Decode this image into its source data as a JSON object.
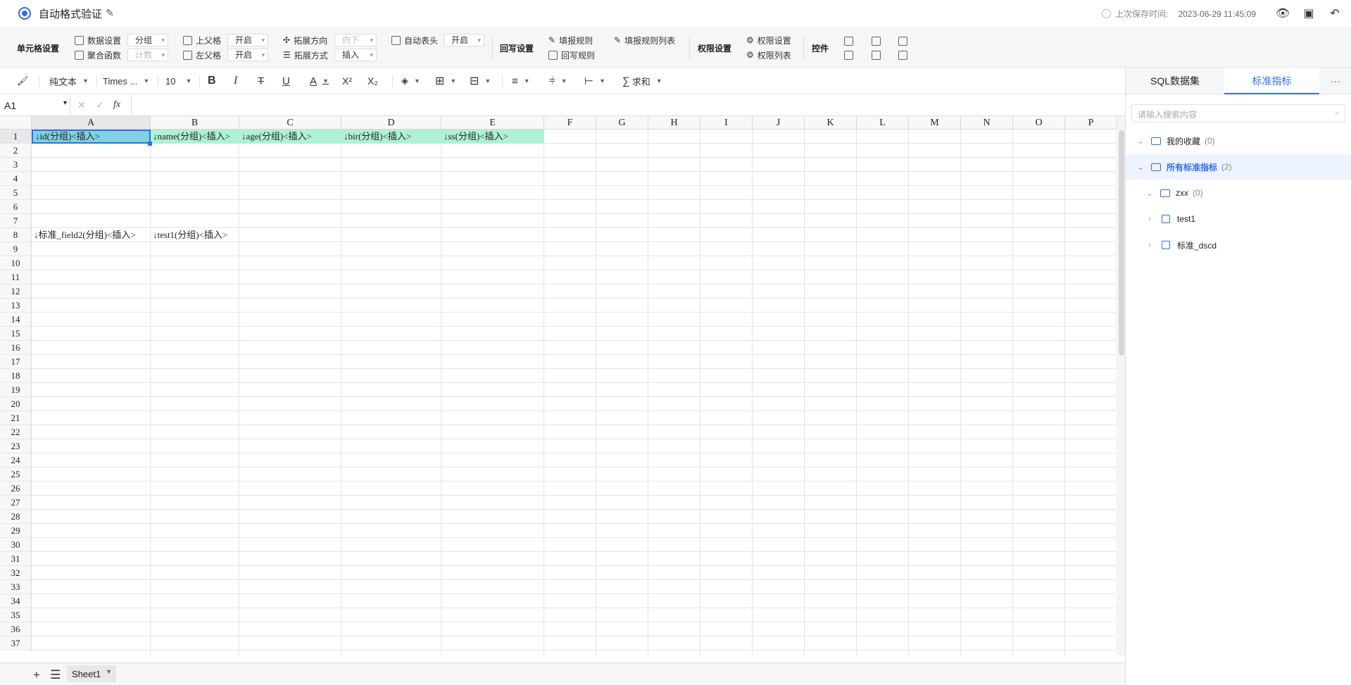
{
  "header": {
    "title": "自动格式验证",
    "save_label": "上次保存时间:",
    "save_time": "2023-06-29 11:45:09"
  },
  "ribbon": {
    "cell_settings": "单元格设置",
    "data_settings": "数据设置",
    "data_settings_value": "分组",
    "agg_func": "聚合函数",
    "agg_func_value": "计数",
    "upper_parent": "上父格",
    "upper_parent_value": "开启",
    "left_parent": "左父格",
    "left_parent_value": "开启",
    "expand_dir": "拓展方向",
    "expand_dir_value": "向下",
    "expand_mode": "拓展方式",
    "expand_mode_value": "插入",
    "auto_header": "自动表头",
    "auto_header_value": "开启",
    "writeback_settings": "回写设置",
    "fill_rules": "填报规则",
    "fill_rules_list": "填报规则列表",
    "writeback_rules": "回写规则",
    "permission_settings_group": "权限设置",
    "permission_settings": "权限设置",
    "permission_list": "权限列表",
    "controls": "控件"
  },
  "toolbar": {
    "format": "纯文本",
    "font": "Times ...",
    "size": "10",
    "sum": "求和"
  },
  "formula_bar": {
    "cell_ref": "A1",
    "fx": "fx"
  },
  "sheet": {
    "columns": [
      "A",
      "B",
      "C",
      "D",
      "E",
      "F",
      "G",
      "H",
      "I",
      "J",
      "K",
      "L",
      "M",
      "N",
      "O",
      "P"
    ],
    "rows": [
      "1",
      "2",
      "3",
      "4",
      "5",
      "6",
      "7",
      "8",
      "9",
      "10",
      "11",
      "12",
      "13",
      "14",
      "15",
      "16",
      "17",
      "18",
      "19",
      "20",
      "21",
      "22",
      "23",
      "24",
      "25",
      "26",
      "27",
      "28",
      "29",
      "30",
      "31",
      "32",
      "33",
      "34",
      "35",
      "36",
      "37"
    ],
    "row1": [
      "↓id(分组)<插入>",
      "↓name(分组)<插入>",
      "↓age(分组)<插入>",
      "↓bir(分组)<插入>",
      "↓ss(分组)<插入>"
    ],
    "row8": [
      "↓标准_field2(分组)<插入>",
      "↓test1(分组)<插入>"
    ]
  },
  "bottom": {
    "sheet_tab": "Sheet1"
  },
  "panel": {
    "tab_sql": "SQL数据集",
    "tab_metrics": "标准指标",
    "more": "···",
    "search_placeholder": "请输入搜索内容",
    "tree": [
      {
        "label": "我的收藏",
        "count": "(0)"
      },
      {
        "label": "所有标准指标",
        "count": "(2)"
      },
      {
        "label": "zxx",
        "count": "(0)"
      },
      {
        "label": "test1",
        "count": ""
      },
      {
        "label": "标准_dscd",
        "count": ""
      }
    ]
  }
}
